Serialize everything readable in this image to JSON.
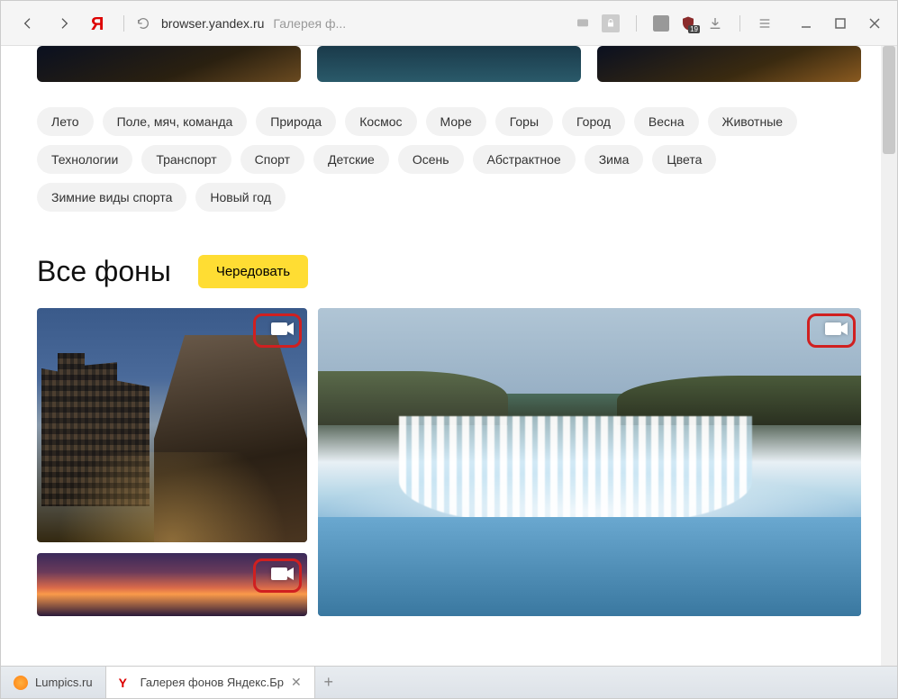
{
  "address": {
    "url": "browser.yandex.ru",
    "title_fragment": "Галерея ф..."
  },
  "toolbar_badge": "19",
  "tags_row1": [
    "Лето",
    "Поле, мяч, команда",
    "Природа",
    "Космос",
    "Море",
    "Горы",
    "Город",
    "Весна",
    "Животные",
    "Технологии"
  ],
  "tags_row2": [
    "Транспорт",
    "Спорт",
    "Детские",
    "Осень",
    "Абстрактное",
    "Зима",
    "Цвета",
    "Зимние виды спорта",
    "Новый год"
  ],
  "heading": "Все фоны",
  "shuffle_button": "Чередовать",
  "tabs": [
    {
      "label": "Lumpics.ru",
      "active": false
    },
    {
      "label": "Галерея фонов Яндекс.Бр",
      "active": true
    }
  ]
}
